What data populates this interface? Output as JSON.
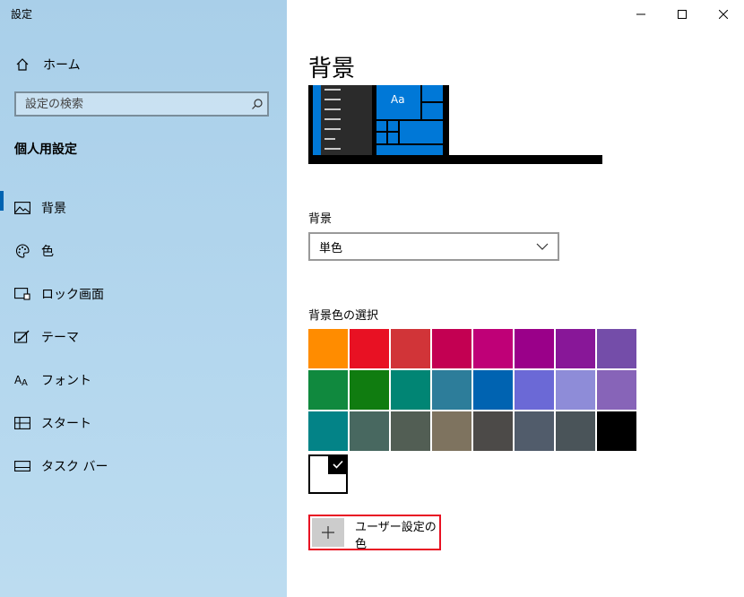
{
  "window": {
    "title": "設定"
  },
  "sidebar": {
    "home_label": "ホーム",
    "search_placeholder": "設定の検索",
    "section_title": "個人用設定",
    "items": [
      {
        "label": "背景",
        "icon": "image-icon",
        "active": true
      },
      {
        "label": "色",
        "icon": "palette-icon",
        "active": false
      },
      {
        "label": "ロック画面",
        "icon": "lock-screen-icon",
        "active": false
      },
      {
        "label": "テーマ",
        "icon": "theme-brush-icon",
        "active": false
      },
      {
        "label": "フォント",
        "icon": "font-icon",
        "active": false
      },
      {
        "label": "スタート",
        "icon": "start-grid-icon",
        "active": false
      },
      {
        "label": "タスク バー",
        "icon": "taskbar-icon",
        "active": false
      }
    ]
  },
  "main": {
    "title": "背景",
    "preview": {
      "tile_text": "Aa"
    },
    "background_label": "背景",
    "background_value": "単色",
    "color_pick_label": "背景色の選択",
    "swatches": [
      "#ff8c00",
      "#e81123",
      "#d13438",
      "#c30052",
      "#bf0077",
      "#9a0089",
      "#881798",
      "#744da9",
      "#10893e",
      "#107c10",
      "#018574",
      "#2d7d9a",
      "#0063b1",
      "#6b69d6",
      "#8e8cd8",
      "#8764b8",
      "#038387",
      "#486860",
      "#525e54",
      "#7e735f",
      "#4c4a48",
      "#515c6b",
      "#4a5459",
      "#000000"
    ],
    "selected_color": "#ffffff",
    "custom_color_label": "ユーザー設定の色"
  },
  "colors": {
    "accent": "#0063b1",
    "highlight_border": "#e81123"
  }
}
